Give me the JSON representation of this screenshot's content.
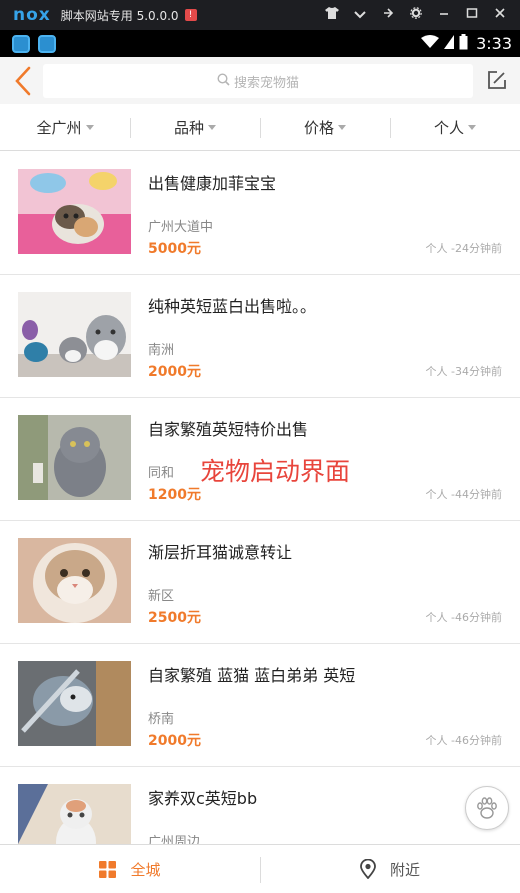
{
  "window": {
    "brand": "nox",
    "title": "脚本网站专用 5.0.0.0",
    "warning_badge": "!",
    "controls": [
      "shirt-icon",
      "chevron-down-icon",
      "pin-icon",
      "gear-icon",
      "minimize-icon",
      "maximize-icon",
      "close-icon"
    ]
  },
  "statusbar": {
    "time": "3:33"
  },
  "header": {
    "search_placeholder": "搜索宠物猫"
  },
  "filters": [
    {
      "label": "全广州"
    },
    {
      "label": "品种"
    },
    {
      "label": "价格"
    },
    {
      "label": "个人"
    }
  ],
  "listings": [
    {
      "title": "出售健康加菲宝宝",
      "location": "广州大道中",
      "price": "5000元",
      "meta": "个人 -24分钟前"
    },
    {
      "title": "纯种英短蓝白出售啦。。",
      "location": "南洲",
      "price": "2000元",
      "meta": "个人 -34分钟前"
    },
    {
      "title": "自家繁殖英短特价出售",
      "location": "同和",
      "price": "1200元",
      "meta": "个人 -44分钟前"
    },
    {
      "title": "渐层折耳猫诚意转让",
      "location": "新区",
      "price": "2500元",
      "meta": "个人 -46分钟前"
    },
    {
      "title": "自家繁殖 蓝猫 蓝白弟弟 英短",
      "location": "桥南",
      "price": "2000元",
      "meta": "个人 -46分钟前"
    },
    {
      "title": "家养双c英短bb",
      "location": "广州周边",
      "price": "",
      "meta": ""
    }
  ],
  "overlay": {
    "text": "宠物启动界面"
  },
  "bottom_tabs": [
    {
      "label": "全城",
      "icon": "grid-icon",
      "active": true
    },
    {
      "label": "附近",
      "icon": "location-pin-icon",
      "active": false
    }
  ],
  "colors": {
    "accent": "#f07a2b",
    "overlay_text": "#e8453c"
  }
}
